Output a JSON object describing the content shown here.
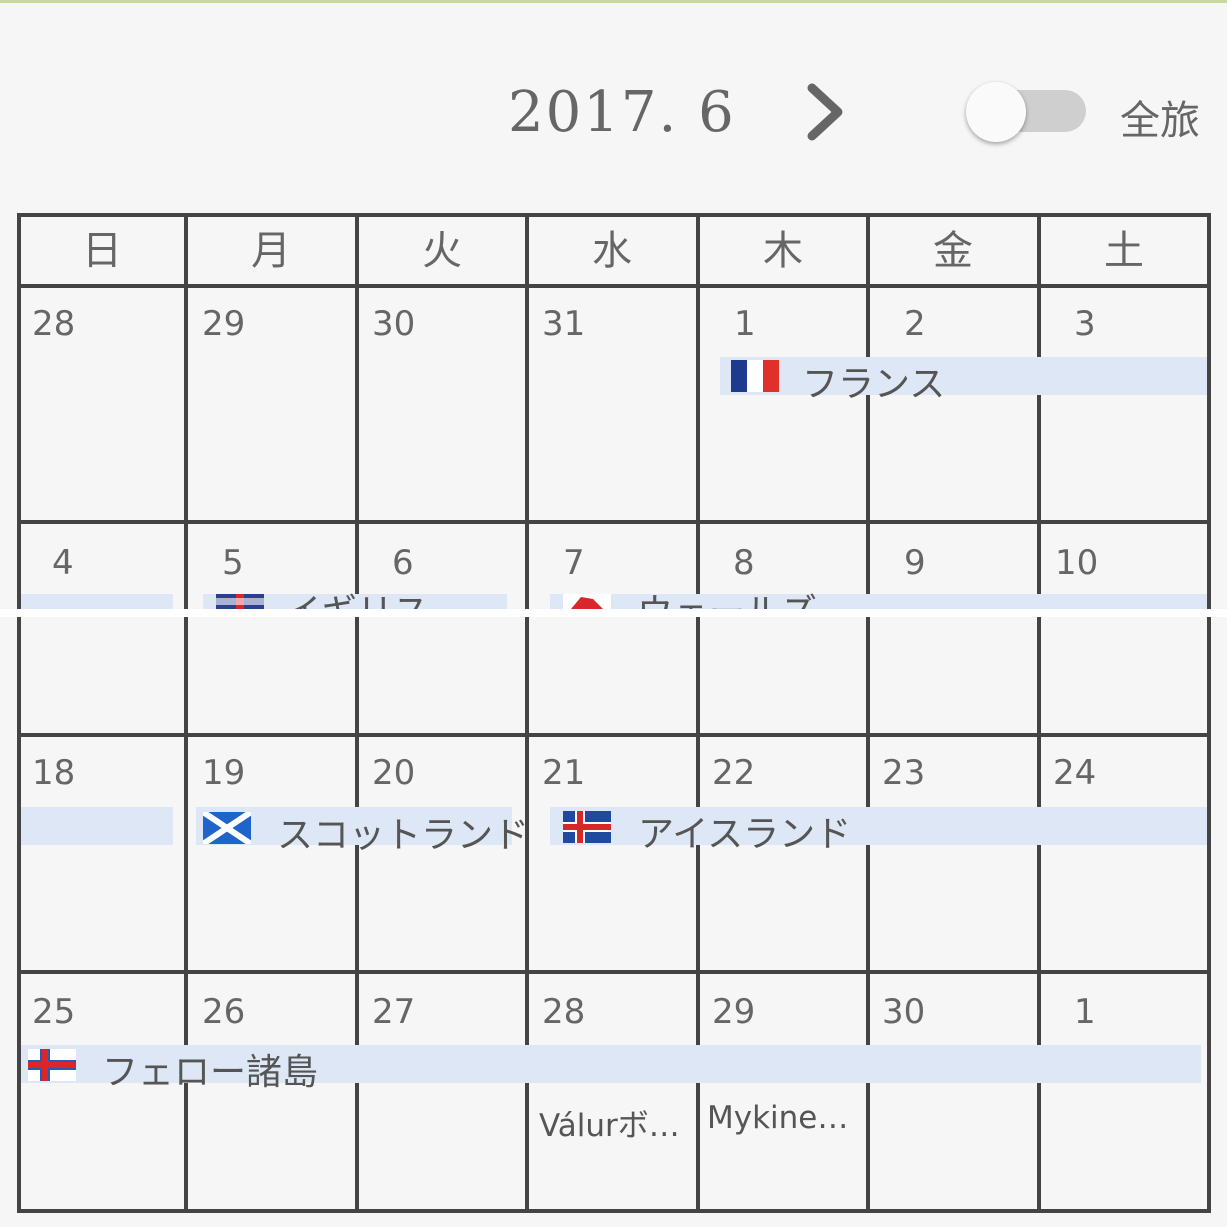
{
  "header": {
    "month_label": "2017. 6",
    "toggle_label": "全旅",
    "toggle_on": false
  },
  "weekdays": [
    "日",
    "月",
    "火",
    "水",
    "木",
    "金",
    "土"
  ],
  "weeks": [
    [
      "28",
      "29",
      "30",
      "31",
      "1",
      "2",
      "3"
    ],
    [
      "4",
      "5",
      "6",
      "7",
      "8",
      "9",
      "10"
    ],
    [
      "18",
      "19",
      "20",
      "21",
      "22",
      "23",
      "24"
    ],
    [
      "25",
      "26",
      "27",
      "28",
      "29",
      "30",
      "1"
    ]
  ],
  "events": {
    "france": "フランス",
    "uk": "イギリス",
    "wales": "ウェールズ",
    "scotland": "スコットランド",
    "iceland": "アイスランド",
    "faroe": "フェロー諸島"
  },
  "notes": {
    "wed28": "Válurボ…",
    "thu29": "Mykine…"
  },
  "colors": {
    "event_bar": "#dde7f5",
    "grid": "#444444",
    "background": "#f6f6f6"
  },
  "icons": [
    "chevron-right-icon",
    "flag-france-icon",
    "flag-uk-icon",
    "flag-wales-icon",
    "flag-scotland-icon",
    "flag-iceland-icon",
    "flag-faroe-icon"
  ]
}
